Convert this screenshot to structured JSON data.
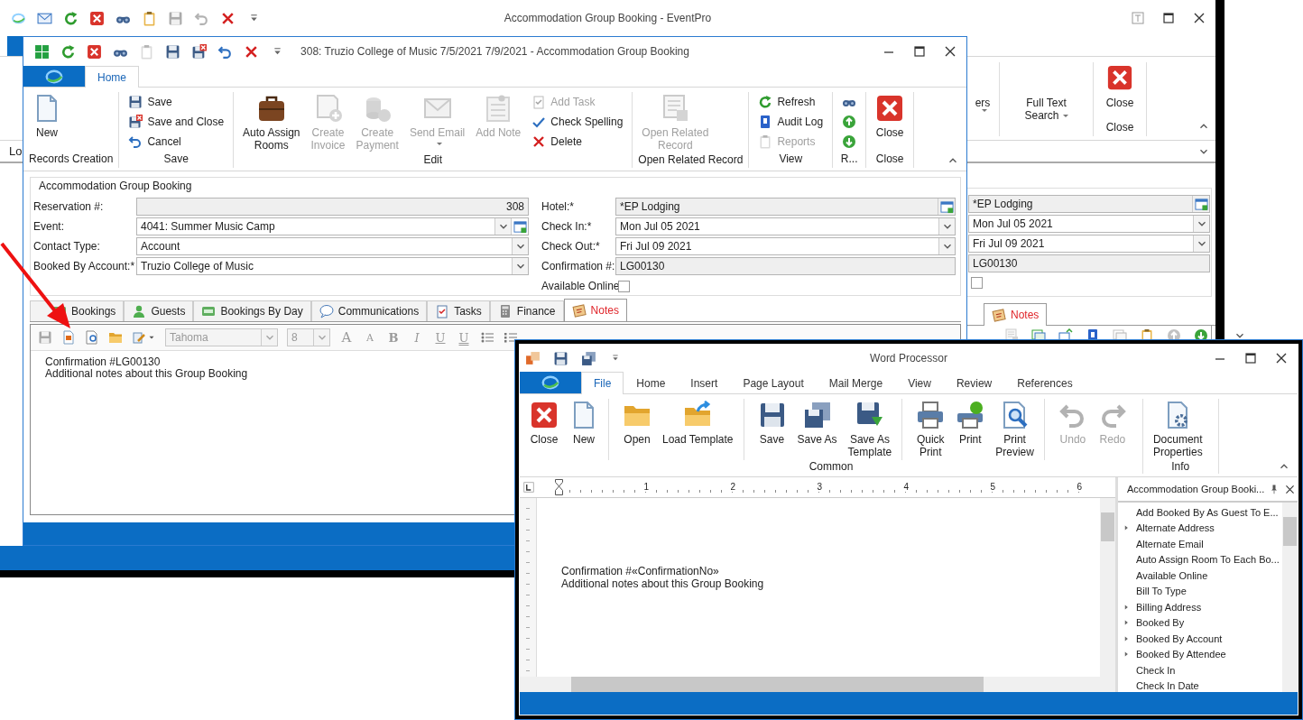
{
  "main_window": {
    "title": "Accommodation Group Booking - EventPro",
    "nav_label": "Lo",
    "ribbon_groups": [
      {
        "buttons": [
          {
            "label": "ers",
            "dropdown": true
          }
        ]
      },
      {
        "buttons": [
          {
            "label": "Full Text\nSearch",
            "dropdown": true
          }
        ]
      },
      {
        "label": "Close",
        "buttons": [
          {
            "label": "Close",
            "dropdown": false
          }
        ]
      }
    ],
    "form": {
      "fields": [
        {
          "value": "*EP Lodging",
          "kind": "lookup"
        },
        {
          "value": "Mon Jul 05 2021",
          "kind": "combo"
        },
        {
          "value": "Fri Jul 09 2021",
          "kind": "combo"
        },
        {
          "value": "LG00130",
          "kind": "readonly"
        }
      ],
      "available_online": {
        "checked": false
      }
    },
    "tabs": [
      {
        "label": "Notes",
        "selected": true
      }
    ]
  },
  "booking_window": {
    "title": "308: Truzio College of Music 7/5/2021 7/9/2021 - Accommodation Group Booking",
    "ribbon_tabs": [
      {
        "label": "Home",
        "selected": true
      }
    ],
    "ribbon_groups": [
      {
        "label": "Records Creation",
        "items": [
          {
            "label": "New",
            "kind": "large",
            "disabled": false
          }
        ]
      },
      {
        "label": "Save",
        "items": [
          {
            "label": "Save",
            "kind": "small",
            "disabled": false
          },
          {
            "label": "Save and Close",
            "kind": "small",
            "disabled": false
          },
          {
            "label": "Cancel",
            "kind": "small",
            "disabled": false
          }
        ]
      },
      {
        "label": "Edit",
        "items": [
          {
            "label": "Auto Assign\nRooms",
            "kind": "large",
            "disabled": false
          },
          {
            "label": "Create\nInvoice",
            "kind": "large",
            "disabled": true
          },
          {
            "label": "Create\nPayment",
            "kind": "large",
            "disabled": true
          },
          {
            "label": "Send Email",
            "kind": "large",
            "disabled": true,
            "dropdown": true
          },
          {
            "label": "Add Note",
            "kind": "large",
            "disabled": true
          },
          {
            "label": "Add Task",
            "kind": "small",
            "disabled": true
          },
          {
            "label": "Check Spelling",
            "kind": "small",
            "disabled": false
          },
          {
            "label": "Delete",
            "kind": "small",
            "disabled": false
          }
        ]
      },
      {
        "label": "Open Related Record",
        "items": [
          {
            "label": "Open Related\nRecord",
            "kind": "large",
            "disabled": true
          }
        ]
      },
      {
        "label": "View",
        "items": [
          {
            "label": "Refresh",
            "kind": "small",
            "disabled": false
          },
          {
            "label": "Audit Log",
            "kind": "small",
            "disabled": false
          },
          {
            "label": "Reports",
            "kind": "small",
            "disabled": true
          }
        ]
      },
      {
        "label": "R...",
        "items": [
          {
            "kind": "small",
            "disabled": false
          },
          {
            "kind": "small",
            "disabled": false
          },
          {
            "kind": "small",
            "disabled": false
          }
        ]
      },
      {
        "label": "Close",
        "items": [
          {
            "label": "Close",
            "kind": "large",
            "disabled": false
          }
        ]
      }
    ],
    "group_title": "Accommodation Group Booking",
    "left_fields": [
      {
        "label": "Reservation #:",
        "value": "308",
        "kind": "number"
      },
      {
        "label": "Event:",
        "value": "4041: Summer Music Camp",
        "kind": "combo-lookup"
      },
      {
        "label": "Contact Type:",
        "value": "Account",
        "kind": "combo"
      },
      {
        "label": "Booked By Account:*",
        "value": "Truzio College of Music",
        "kind": "combo"
      }
    ],
    "right_fields": [
      {
        "label": "Hotel:*",
        "value": "*EP Lodging",
        "kind": "lookup"
      },
      {
        "label": "Check In:*",
        "value": "Mon Jul 05 2021",
        "kind": "combo"
      },
      {
        "label": "Check Out:*",
        "value": "Fri Jul 09 2021",
        "kind": "combo"
      },
      {
        "label": "Confirmation #:",
        "value": "LG00130",
        "kind": "readonly"
      },
      {
        "label": "Available Online",
        "checked": false,
        "kind": "checkbox"
      }
    ],
    "tabs": [
      {
        "label": "Bookings",
        "selected": false
      },
      {
        "label": "Guests",
        "selected": false
      },
      {
        "label": "Bookings By Day",
        "selected": false
      },
      {
        "label": "Communications",
        "selected": false
      },
      {
        "label": "Tasks",
        "selected": false
      },
      {
        "label": "Finance",
        "selected": false
      },
      {
        "label": "Notes",
        "selected": true
      }
    ],
    "editor": {
      "font": "Tahoma",
      "size": "8",
      "format_buttons": [
        {
          "label": "A",
          "kind": "grow"
        },
        {
          "label": "A",
          "kind": "shrink"
        },
        {
          "label": "B",
          "kind": "bold"
        },
        {
          "label": "I",
          "kind": "italic"
        },
        {
          "label": "U",
          "kind": "underline"
        },
        {
          "label": "U",
          "kind": "double-underline"
        }
      ],
      "lines": [
        "Confirmation #LG00130",
        "Additional notes about this Group Booking"
      ]
    }
  },
  "word_processor": {
    "title": "Word Processor",
    "tabs": [
      {
        "label": "File",
        "selected": true
      },
      {
        "label": "Home",
        "selected": false
      },
      {
        "label": "Insert",
        "selected": false
      },
      {
        "label": "Page Layout",
        "selected": false
      },
      {
        "label": "Mail Merge",
        "selected": false
      },
      {
        "label": "View",
        "selected": false
      },
      {
        "label": "Review",
        "selected": false
      },
      {
        "label": "References",
        "selected": false
      }
    ],
    "groups": [
      {
        "label": "Common",
        "clusters": [
          [
            {
              "label": "Close",
              "disabled": false
            },
            {
              "label": "New",
              "disabled": false
            }
          ],
          [
            {
              "label": "Open",
              "disabled": false
            },
            {
              "label": "Load Template",
              "disabled": false
            }
          ],
          [
            {
              "label": "Save",
              "disabled": false
            },
            {
              "label": "Save As",
              "disabled": false
            },
            {
              "label": "Save As\nTemplate",
              "disabled": false
            }
          ],
          [
            {
              "label": "Quick\nPrint",
              "disabled": false
            },
            {
              "label": "Print",
              "disabled": false
            },
            {
              "label": "Print\nPreview",
              "disabled": false
            }
          ],
          [
            {
              "label": "Undo",
              "disabled": true
            },
            {
              "label": "Redo",
              "disabled": true
            }
          ]
        ]
      },
      {
        "label": "Info",
        "clusters": [
          [
            {
              "label": "Document\nProperties",
              "disabled": false
            }
          ]
        ]
      }
    ],
    "ruler": [
      "1",
      "2",
      "3",
      "4",
      "5",
      "6"
    ],
    "document": [
      "Confirmation #«ConfirmationNo»",
      "Additional notes about this Group Booking"
    ],
    "fields_panel": {
      "title": "Accommodation Group Booki...",
      "items": [
        {
          "label": "Add Booked By As Guest To E...",
          "has_children": false
        },
        {
          "label": "Alternate Address",
          "has_children": true
        },
        {
          "label": "Alternate Email",
          "has_children": false
        },
        {
          "label": "Auto Assign Room To Each Bo...",
          "has_children": false
        },
        {
          "label": "Available Online",
          "has_children": false
        },
        {
          "label": "Bill To Type",
          "has_children": false
        },
        {
          "label": "Billing Address",
          "has_children": true
        },
        {
          "label": "Booked By",
          "has_children": true
        },
        {
          "label": "Booked By Account",
          "has_children": true
        },
        {
          "label": "Booked By Attendee",
          "has_children": true
        },
        {
          "label": "Check In",
          "has_children": false
        },
        {
          "label": "Check In Date",
          "has_children": false
        }
      ]
    }
  }
}
